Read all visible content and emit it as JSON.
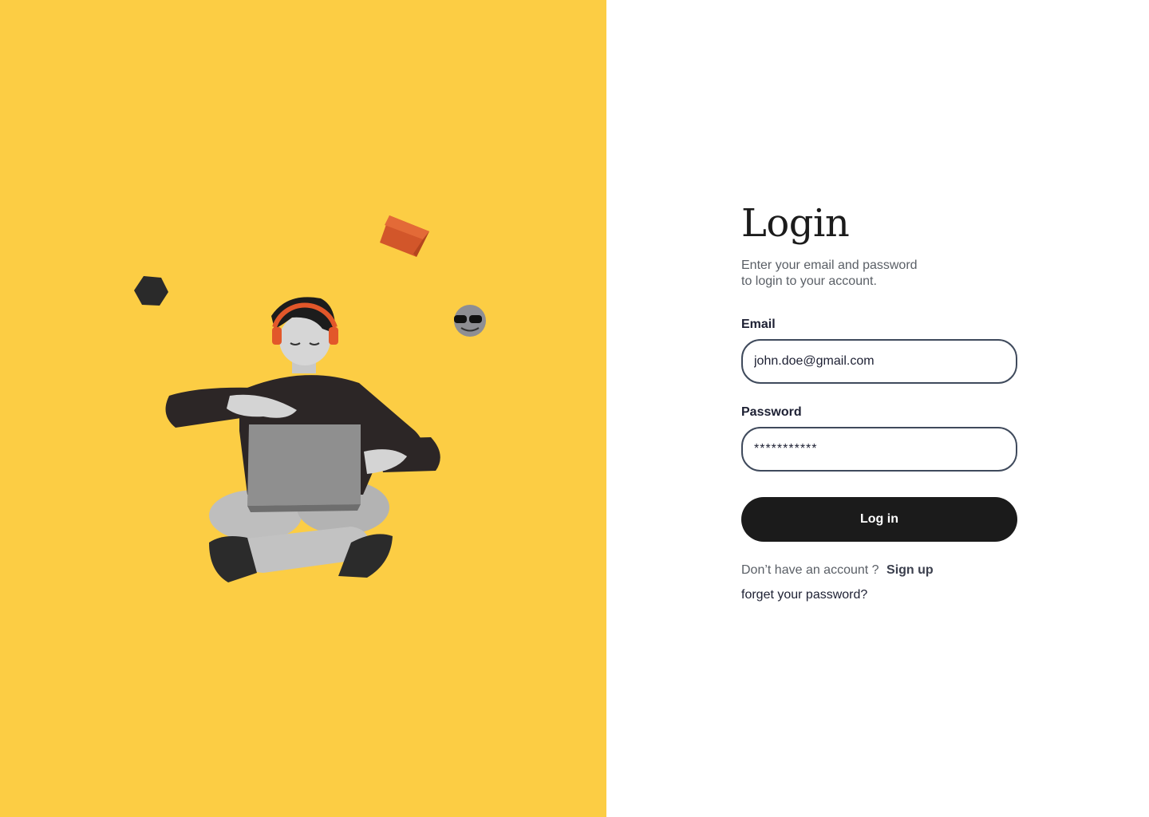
{
  "colors": {
    "left_panel_bg": "#FCCD44",
    "button_bg": "#1B1B1B",
    "input_border": "#3F4A5C"
  },
  "illustration": {
    "icons": [
      "person-with-laptop-illustration",
      "orange-cube-icon",
      "black-hexagon-icon",
      "sunglasses-emoji-icon"
    ]
  },
  "login": {
    "title": "Login",
    "subtitle_line1": "Enter your email and password",
    "subtitle_line2": "to login to your account.",
    "email": {
      "label": "Email",
      "value": "john.doe@gmail.com"
    },
    "password": {
      "label": "Password",
      "value": "***********"
    },
    "submit_label": "Log in",
    "signup_prompt": "Don’t have an account ?",
    "signup_link": "Sign up",
    "forgot_link": "forget your password?"
  }
}
